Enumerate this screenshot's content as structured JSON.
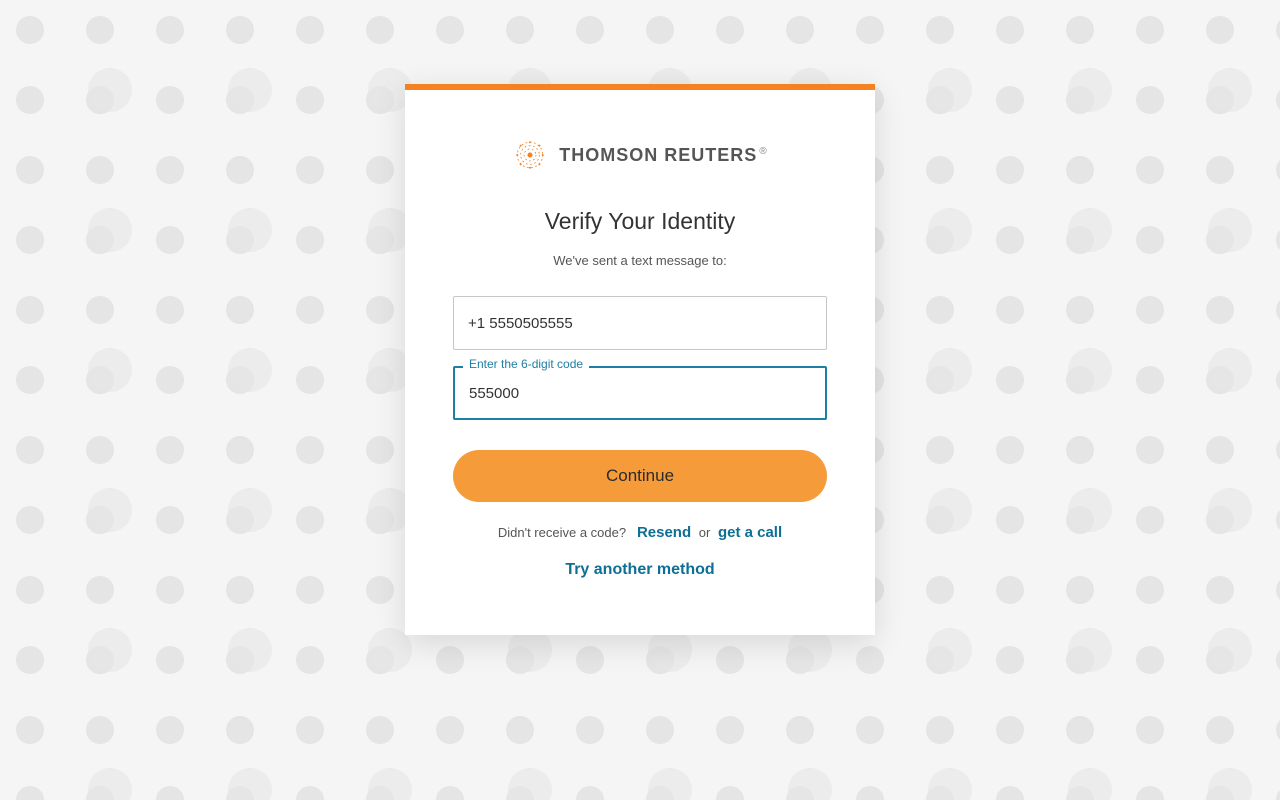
{
  "brand": {
    "name": "THOMSON REUTERS",
    "reg": "®"
  },
  "heading": "Verify Your Identity",
  "subheading": "We've sent a text message to:",
  "phone": {
    "value": "+1 5550505555"
  },
  "code": {
    "label": "Enter the 6‑digit code",
    "value": "555000"
  },
  "continue_label": "Continue",
  "resend": {
    "prefix": "Didn't receive a code?",
    "resend_label": "Resend",
    "or": "or",
    "call_label": "get a call"
  },
  "another_method": "Try another method",
  "colors": {
    "accent_orange": "#f58220",
    "button_orange": "#f59b3a",
    "link_blue": "#0e6f95",
    "focus_blue": "#1d7fa3"
  }
}
